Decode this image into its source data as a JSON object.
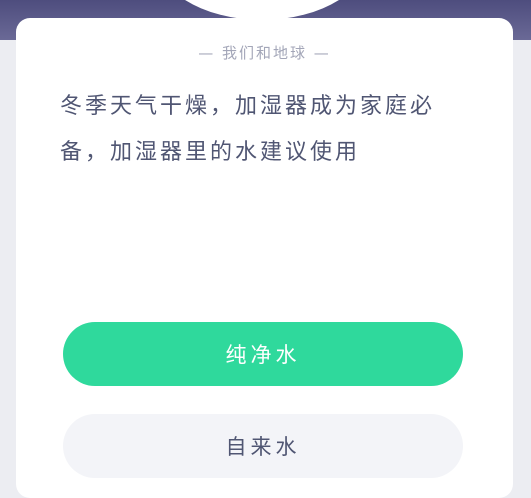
{
  "header": {
    "label": "— 我们和地球 —"
  },
  "question": {
    "text": "冬季天气干燥，加湿器成为家庭必备，加湿器里的水建议使用"
  },
  "options": [
    {
      "label": "纯净水",
      "selected": true
    },
    {
      "label": "自来水",
      "selected": false
    }
  ],
  "colors": {
    "top_band": "#5b5a8a",
    "accent_green": "#2fd99c",
    "option_neutral": "#f3f4f8",
    "text_primary": "#505673",
    "text_muted": "#a3a6b8"
  }
}
